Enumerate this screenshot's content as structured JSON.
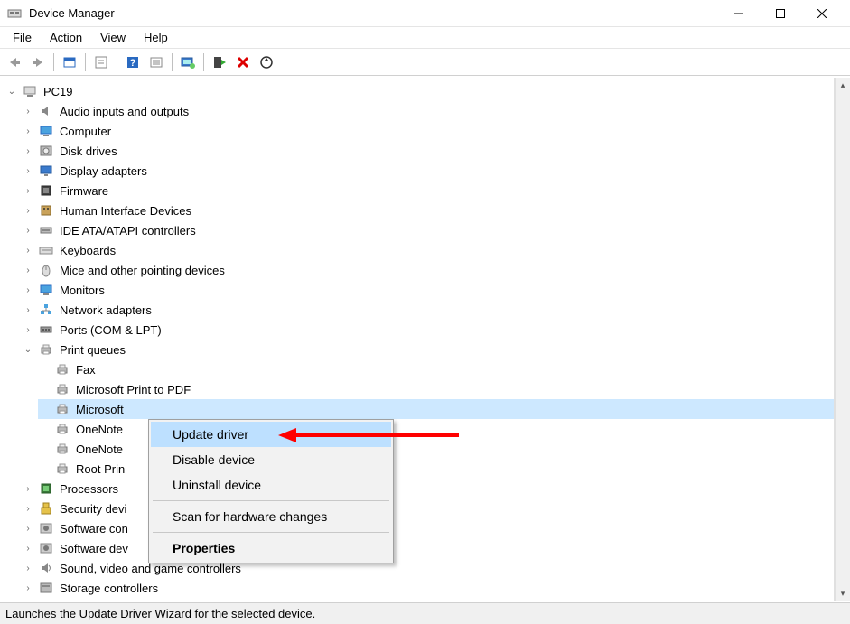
{
  "window": {
    "title": "Device Manager"
  },
  "menus": {
    "file": "File",
    "action": "Action",
    "view": "View",
    "help": "Help"
  },
  "tree": {
    "root": "PC19",
    "categories": [
      {
        "label": "Audio inputs and outputs",
        "icon": "speaker"
      },
      {
        "label": "Computer",
        "icon": "monitor"
      },
      {
        "label": "Disk drives",
        "icon": "disk"
      },
      {
        "label": "Display adapters",
        "icon": "display"
      },
      {
        "label": "Firmware",
        "icon": "chip"
      },
      {
        "label": "Human Interface Devices",
        "icon": "hid"
      },
      {
        "label": "IDE ATA/ATAPI controllers",
        "icon": "ide"
      },
      {
        "label": "Keyboards",
        "icon": "keyboard"
      },
      {
        "label": "Mice and other pointing devices",
        "icon": "mouse"
      },
      {
        "label": "Monitors",
        "icon": "monitor"
      },
      {
        "label": "Network adapters",
        "icon": "network"
      },
      {
        "label": "Ports (COM & LPT)",
        "icon": "port"
      }
    ],
    "print_queues": {
      "label": "Print queues",
      "children": [
        {
          "label": "Fax"
        },
        {
          "label": "Microsoft Print to PDF"
        },
        {
          "label_full": "Microsoft XPS Document Writer",
          "label_visible": "Microsoft ",
          "selected": true
        },
        {
          "label_full": "OneNote",
          "label_visible": "OneNote"
        },
        {
          "label_full": "OneNote",
          "label_visible": "OneNote"
        },
        {
          "label_full": "Root Printer",
          "label_visible": "Root Prin"
        }
      ]
    },
    "after": [
      {
        "label": "Processors",
        "icon": "cpu"
      },
      {
        "label_full": "Security devices",
        "label_visible": "Security devi",
        "icon": "security"
      },
      {
        "label_full": "Software controllers",
        "label_visible": "Software con",
        "icon": "software"
      },
      {
        "label_full": "Software devices",
        "label_visible": "Software dev",
        "icon": "software"
      },
      {
        "label": "Sound, video and game controllers",
        "icon": "sound"
      },
      {
        "label_full": "Storage controllers",
        "label_visible": "Storage controllers",
        "icon": "storage"
      }
    ]
  },
  "context_menu": {
    "items": [
      {
        "label": "Update driver",
        "hover": true
      },
      {
        "label": "Disable device"
      },
      {
        "label": "Uninstall device"
      },
      {
        "sep": true
      },
      {
        "label": "Scan for hardware changes"
      },
      {
        "sep": true
      },
      {
        "label": "Properties",
        "strong": true
      }
    ]
  },
  "statusbar": {
    "text": "Launches the Update Driver Wizard for the selected device."
  }
}
